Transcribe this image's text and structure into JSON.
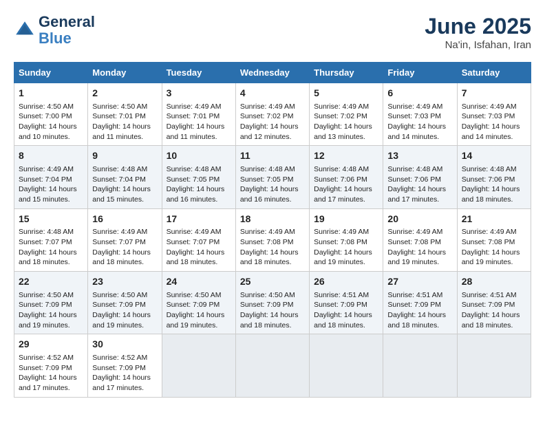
{
  "logo": {
    "line1": "General",
    "line2": "Blue"
  },
  "title": "June 2025",
  "location": "Na'in, Isfahan, Iran",
  "headers": [
    "Sunday",
    "Monday",
    "Tuesday",
    "Wednesday",
    "Thursday",
    "Friday",
    "Saturday"
  ],
  "weeks": [
    [
      {
        "day": "1",
        "sunrise": "Sunrise: 4:50 AM",
        "sunset": "Sunset: 7:00 PM",
        "daylight": "Daylight: 14 hours and 10 minutes."
      },
      {
        "day": "2",
        "sunrise": "Sunrise: 4:50 AM",
        "sunset": "Sunset: 7:01 PM",
        "daylight": "Daylight: 14 hours and 11 minutes."
      },
      {
        "day": "3",
        "sunrise": "Sunrise: 4:49 AM",
        "sunset": "Sunset: 7:01 PM",
        "daylight": "Daylight: 14 hours and 11 minutes."
      },
      {
        "day": "4",
        "sunrise": "Sunrise: 4:49 AM",
        "sunset": "Sunset: 7:02 PM",
        "daylight": "Daylight: 14 hours and 12 minutes."
      },
      {
        "day": "5",
        "sunrise": "Sunrise: 4:49 AM",
        "sunset": "Sunset: 7:02 PM",
        "daylight": "Daylight: 14 hours and 13 minutes."
      },
      {
        "day": "6",
        "sunrise": "Sunrise: 4:49 AM",
        "sunset": "Sunset: 7:03 PM",
        "daylight": "Daylight: 14 hours and 14 minutes."
      },
      {
        "day": "7",
        "sunrise": "Sunrise: 4:49 AM",
        "sunset": "Sunset: 7:03 PM",
        "daylight": "Daylight: 14 hours and 14 minutes."
      }
    ],
    [
      {
        "day": "8",
        "sunrise": "Sunrise: 4:49 AM",
        "sunset": "Sunset: 7:04 PM",
        "daylight": "Daylight: 14 hours and 15 minutes."
      },
      {
        "day": "9",
        "sunrise": "Sunrise: 4:48 AM",
        "sunset": "Sunset: 7:04 PM",
        "daylight": "Daylight: 14 hours and 15 minutes."
      },
      {
        "day": "10",
        "sunrise": "Sunrise: 4:48 AM",
        "sunset": "Sunset: 7:05 PM",
        "daylight": "Daylight: 14 hours and 16 minutes."
      },
      {
        "day": "11",
        "sunrise": "Sunrise: 4:48 AM",
        "sunset": "Sunset: 7:05 PM",
        "daylight": "Daylight: 14 hours and 16 minutes."
      },
      {
        "day": "12",
        "sunrise": "Sunrise: 4:48 AM",
        "sunset": "Sunset: 7:06 PM",
        "daylight": "Daylight: 14 hours and 17 minutes."
      },
      {
        "day": "13",
        "sunrise": "Sunrise: 4:48 AM",
        "sunset": "Sunset: 7:06 PM",
        "daylight": "Daylight: 14 hours and 17 minutes."
      },
      {
        "day": "14",
        "sunrise": "Sunrise: 4:48 AM",
        "sunset": "Sunset: 7:06 PM",
        "daylight": "Daylight: 14 hours and 18 minutes."
      }
    ],
    [
      {
        "day": "15",
        "sunrise": "Sunrise: 4:48 AM",
        "sunset": "Sunset: 7:07 PM",
        "daylight": "Daylight: 14 hours and 18 minutes."
      },
      {
        "day": "16",
        "sunrise": "Sunrise: 4:49 AM",
        "sunset": "Sunset: 7:07 PM",
        "daylight": "Daylight: 14 hours and 18 minutes."
      },
      {
        "day": "17",
        "sunrise": "Sunrise: 4:49 AM",
        "sunset": "Sunset: 7:07 PM",
        "daylight": "Daylight: 14 hours and 18 minutes."
      },
      {
        "day": "18",
        "sunrise": "Sunrise: 4:49 AM",
        "sunset": "Sunset: 7:08 PM",
        "daylight": "Daylight: 14 hours and 18 minutes."
      },
      {
        "day": "19",
        "sunrise": "Sunrise: 4:49 AM",
        "sunset": "Sunset: 7:08 PM",
        "daylight": "Daylight: 14 hours and 19 minutes."
      },
      {
        "day": "20",
        "sunrise": "Sunrise: 4:49 AM",
        "sunset": "Sunset: 7:08 PM",
        "daylight": "Daylight: 14 hours and 19 minutes."
      },
      {
        "day": "21",
        "sunrise": "Sunrise: 4:49 AM",
        "sunset": "Sunset: 7:08 PM",
        "daylight": "Daylight: 14 hours and 19 minutes."
      }
    ],
    [
      {
        "day": "22",
        "sunrise": "Sunrise: 4:50 AM",
        "sunset": "Sunset: 7:09 PM",
        "daylight": "Daylight: 14 hours and 19 minutes."
      },
      {
        "day": "23",
        "sunrise": "Sunrise: 4:50 AM",
        "sunset": "Sunset: 7:09 PM",
        "daylight": "Daylight: 14 hours and 19 minutes."
      },
      {
        "day": "24",
        "sunrise": "Sunrise: 4:50 AM",
        "sunset": "Sunset: 7:09 PM",
        "daylight": "Daylight: 14 hours and 19 minutes."
      },
      {
        "day": "25",
        "sunrise": "Sunrise: 4:50 AM",
        "sunset": "Sunset: 7:09 PM",
        "daylight": "Daylight: 14 hours and 18 minutes."
      },
      {
        "day": "26",
        "sunrise": "Sunrise: 4:51 AM",
        "sunset": "Sunset: 7:09 PM",
        "daylight": "Daylight: 14 hours and 18 minutes."
      },
      {
        "day": "27",
        "sunrise": "Sunrise: 4:51 AM",
        "sunset": "Sunset: 7:09 PM",
        "daylight": "Daylight: 14 hours and 18 minutes."
      },
      {
        "day": "28",
        "sunrise": "Sunrise: 4:51 AM",
        "sunset": "Sunset: 7:09 PM",
        "daylight": "Daylight: 14 hours and 18 minutes."
      }
    ],
    [
      {
        "day": "29",
        "sunrise": "Sunrise: 4:52 AM",
        "sunset": "Sunset: 7:09 PM",
        "daylight": "Daylight: 14 hours and 17 minutes."
      },
      {
        "day": "30",
        "sunrise": "Sunrise: 4:52 AM",
        "sunset": "Sunset: 7:09 PM",
        "daylight": "Daylight: 14 hours and 17 minutes."
      },
      null,
      null,
      null,
      null,
      null
    ]
  ]
}
